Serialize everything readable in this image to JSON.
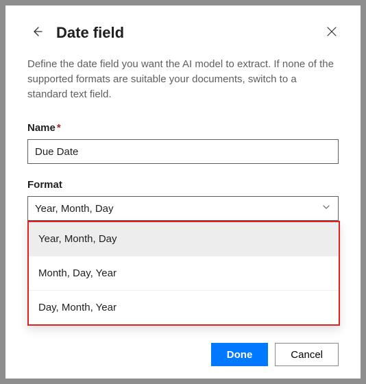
{
  "header": {
    "title": "Date field"
  },
  "description": "Define the date field you want the AI model to extract. If none of the supported formats are suitable your documents, switch to a standard text field.",
  "nameField": {
    "label": "Name",
    "required": "*",
    "value": "Due Date"
  },
  "formatField": {
    "label": "Format",
    "selected": "Year, Month, Day",
    "options": [
      "Year, Month, Day",
      "Month, Day, Year",
      "Day, Month, Year"
    ]
  },
  "buttons": {
    "done": "Done",
    "cancel": "Cancel"
  },
  "colors": {
    "primary": "#0078ff",
    "highlight": "#e22020"
  }
}
